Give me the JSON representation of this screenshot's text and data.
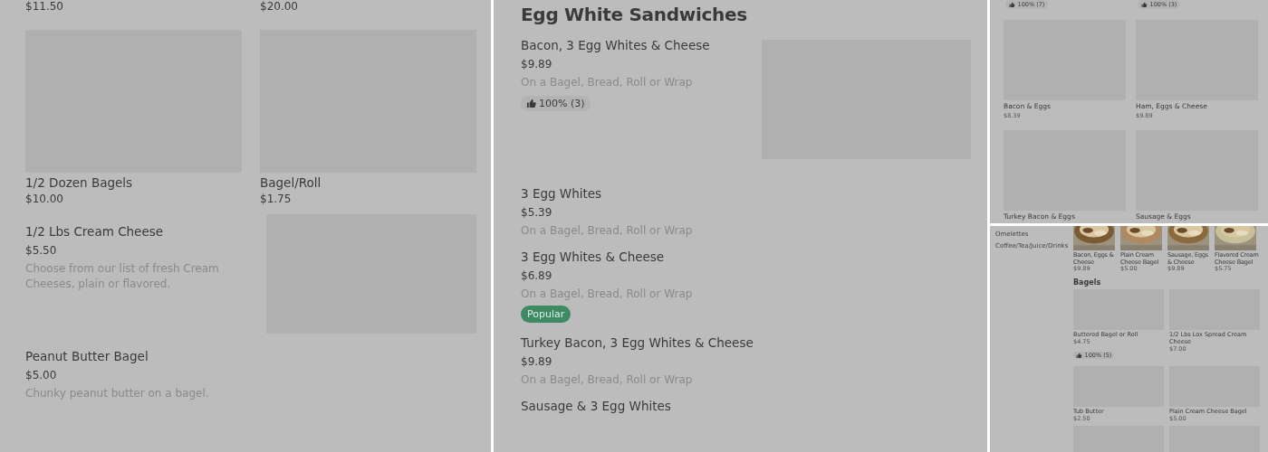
{
  "panels": [
    {
      "kind": "grid-list",
      "partial_prices": [
        "$11.50",
        "$20.00"
      ],
      "cards": [
        {
          "name": "1/2 Dozen Bagels",
          "price": "$10.00"
        },
        {
          "name": "Bagel/Roll",
          "price": "$1.75"
        }
      ],
      "items": [
        {
          "name": "1/2 Lbs Cream Cheese",
          "price": "$5.50",
          "description": "Choose from our list of fresh Cream Cheeses, plain or flavored.",
          "image": true
        },
        {
          "name": "Peanut Butter Bagel",
          "price": "$5.00",
          "description": "Chunky peanut butter on a bagel.",
          "image": false
        }
      ]
    },
    {
      "kind": "list",
      "heading": "Egg White Sandwiches",
      "items": [
        {
          "name": "Bacon, 3 Egg Whites & Cheese",
          "price": "$9.89",
          "description": "On a Bagel, Bread, Roll or Wrap",
          "rating": "100% (3)",
          "image": true
        },
        {
          "name": "3 Egg Whites",
          "price": "$5.39",
          "description": "On a Bagel, Bread, Roll or Wrap",
          "image": false
        },
        {
          "name": "3 Egg Whites & Cheese",
          "price": "$6.89",
          "description": "On a Bagel, Bread, Roll or Wrap",
          "badge": "Popular",
          "image": false
        },
        {
          "name": "Turkey Bacon, 3 Egg Whites & Cheese",
          "price": "$9.89",
          "description": "On a Bagel, Bread, Roll or Wrap",
          "image": false
        },
        {
          "name": "Sausage & 3 Egg Whites",
          "image": false
        }
      ]
    },
    {
      "kind": "mini-grid",
      "ratings": [
        "100% (7)",
        "100% (3)"
      ],
      "cards": [
        {
          "name": "Bacon & Eggs",
          "price": "$8.39"
        },
        {
          "name": "Ham, Eggs & Cheese",
          "price": "$9.89"
        },
        {
          "name": "Turkey Bacon & Eggs"
        },
        {
          "name": "Sausage & Eggs"
        }
      ]
    },
    {
      "kind": "sidebar-grid",
      "sidebar": {
        "items": [
          {
            "label": "Omelettes"
          },
          {
            "label": "Coffee/Tea/Juice/Drinks"
          }
        ]
      },
      "featured": [
        {
          "name": "Bacon, Eggs & Cheese",
          "price": "$9.89",
          "kind": "picture"
        },
        {
          "name": "Plain Cream Cheese Bagel",
          "price": "$5.00",
          "kind": "picture"
        },
        {
          "name": "Sausage, Eggs & Cheese",
          "price": "$9.89",
          "kind": "picture"
        },
        {
          "name": "Flavored Cream Cheese Bagel",
          "price": "$5.75",
          "kind": "picture"
        }
      ],
      "section_title": "Bagels",
      "cards": [
        {
          "kind": "product",
          "name": "Buttered Bagel or Roll",
          "price": "$4.75",
          "rating": "100% (5)"
        },
        {
          "kind": "product",
          "name": "1/2 Lbs Lox Spread Cream Cheese",
          "price": "$7.00"
        },
        {
          "kind": "product",
          "name": "Tub Butter",
          "price": "$2.50"
        },
        {
          "kind": "product",
          "name": "Plain Cream Cheese Bagel",
          "price": "$5.00"
        },
        {
          "kind": "image-only"
        },
        {
          "kind": "image-only"
        }
      ]
    }
  ]
}
